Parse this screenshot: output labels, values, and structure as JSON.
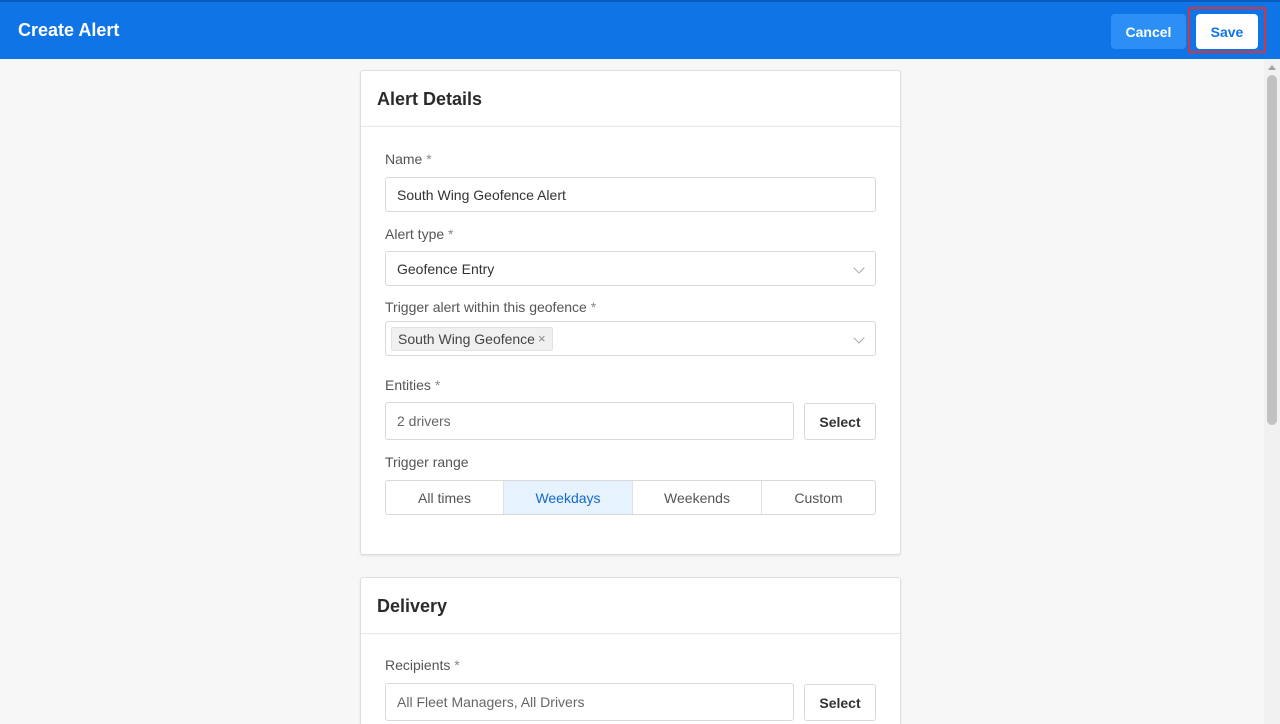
{
  "header": {
    "title": "Create Alert",
    "cancel_label": "Cancel",
    "save_label": "Save"
  },
  "alert_details": {
    "title": "Alert Details",
    "name_label": "Name",
    "name_value": "South Wing Geofence Alert",
    "alert_type_label": "Alert type",
    "alert_type_value": "Geofence Entry",
    "geofence_label": "Trigger alert within this geofence",
    "geofence_tag": "South Wing Geofence",
    "entities_label": "Entities",
    "entities_value": "2 drivers",
    "select_label": "Select",
    "trigger_range_label": "Trigger range",
    "trigger_range_options": [
      "All times",
      "Weekdays",
      "Weekends",
      "Custom"
    ],
    "trigger_range_selected": "Weekdays"
  },
  "delivery": {
    "title": "Delivery",
    "recipients_label": "Recipients",
    "recipients_value": "All Fleet Managers, All Drivers",
    "select_label": "Select"
  },
  "required_marker": "*",
  "colors": {
    "header_bg": "#0f74e6",
    "active_segment_bg": "#e6f2fd",
    "highlight_outline": "#d9343a"
  }
}
